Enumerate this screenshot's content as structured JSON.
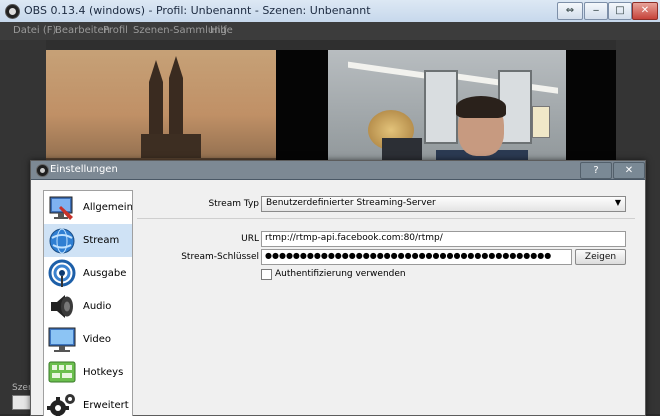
{
  "window": {
    "title": "OBS 0.13.4 (windows) - Profil: Unbenannt - Szenen: Unbenannt"
  },
  "menu": [
    "Datei (F)",
    "Bearbeiten",
    "Profil",
    "Szenen-Sammlung",
    "Hilfe"
  ],
  "background_labels": {
    "scenes_label": "Szen"
  },
  "dialog": {
    "title": "Einstellungen",
    "help_label": "?",
    "close_label": "✕",
    "sidebar": [
      {
        "label": "Allgemein",
        "icon": "monitor-settings-icon"
      },
      {
        "label": "Stream",
        "icon": "globe-stream-icon"
      },
      {
        "label": "Ausgabe",
        "icon": "broadcast-icon"
      },
      {
        "label": "Audio",
        "icon": "speaker-icon"
      },
      {
        "label": "Video",
        "icon": "monitor-icon"
      },
      {
        "label": "Hotkeys",
        "icon": "keyboard-icon"
      },
      {
        "label": "Erweitert",
        "icon": "gears-icon"
      }
    ],
    "selected_item": "Stream",
    "stream": {
      "type_label": "Stream Typ",
      "type_value": "Benutzerdefinierter Streaming-Server",
      "url_label": "URL",
      "url_value": "rtmp://rtmp-api.facebook.com:80/rtmp/",
      "key_label": "Stream-Schlüssel",
      "key_value": "●●●●●●●●●●●●●●●●●●●●●●●●●●●●●●●●●●●●●●●●●",
      "show_button": "Zeigen",
      "auth_label": "Authentifizierung verwenden",
      "auth_checked": false
    }
  },
  "colors": {
    "selected_bg": "#cfe2f5",
    "dialog_bg": "#f0f0f0",
    "obs_dark": "#3a3a3a"
  }
}
